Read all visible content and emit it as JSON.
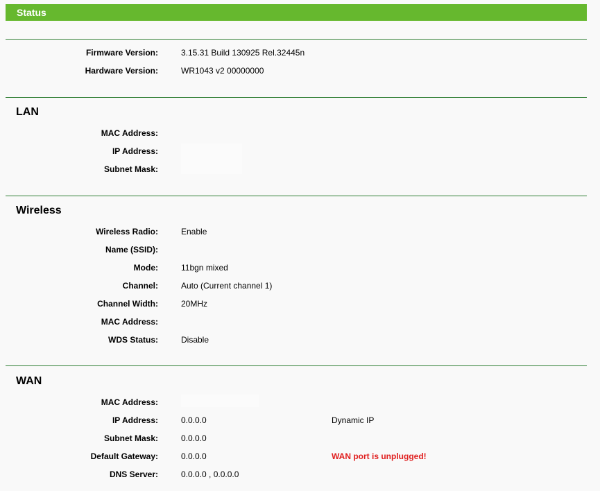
{
  "header": {
    "title": "Status"
  },
  "device": {
    "firmware_label": "Firmware Version:",
    "firmware_value": "3.15.31 Build 130925 Rel.32445n",
    "hardware_label": "Hardware Version:",
    "hardware_value": "WR1043 v2 00000000"
  },
  "lan": {
    "title": "LAN",
    "mac_label": "MAC Address:",
    "ip_label": "IP Address:",
    "mask_label": "Subnet Mask:"
  },
  "wireless": {
    "title": "Wireless",
    "radio_label": "Wireless Radio:",
    "radio_value": "Enable",
    "ssid_label": "Name (SSID):",
    "mode_label": "Mode:",
    "mode_value": "11bgn mixed",
    "channel_label": "Channel:",
    "channel_value": "Auto (Current channel 1)",
    "width_label": "Channel Width:",
    "width_value": "20MHz",
    "mac_label": "MAC Address:",
    "wds_label": "WDS Status:",
    "wds_value": "Disable"
  },
  "wan": {
    "title": "WAN",
    "mac_label": "MAC Address:",
    "ip_label": "IP Address:",
    "ip_value": "0.0.0.0",
    "ip_type": "Dynamic IP",
    "mask_label": "Subnet Mask:",
    "mask_value": "0.0.0.0",
    "gateway_label": "Default Gateway:",
    "gateway_value": "0.0.0.0",
    "gateway_status": "WAN port is unplugged!",
    "dns_label": "DNS Server:",
    "dns_value": "0.0.0.0 , 0.0.0.0"
  },
  "colors": {
    "header_bg": "#66b82e",
    "divider": "#2e7d32",
    "warning": "#e02020"
  }
}
